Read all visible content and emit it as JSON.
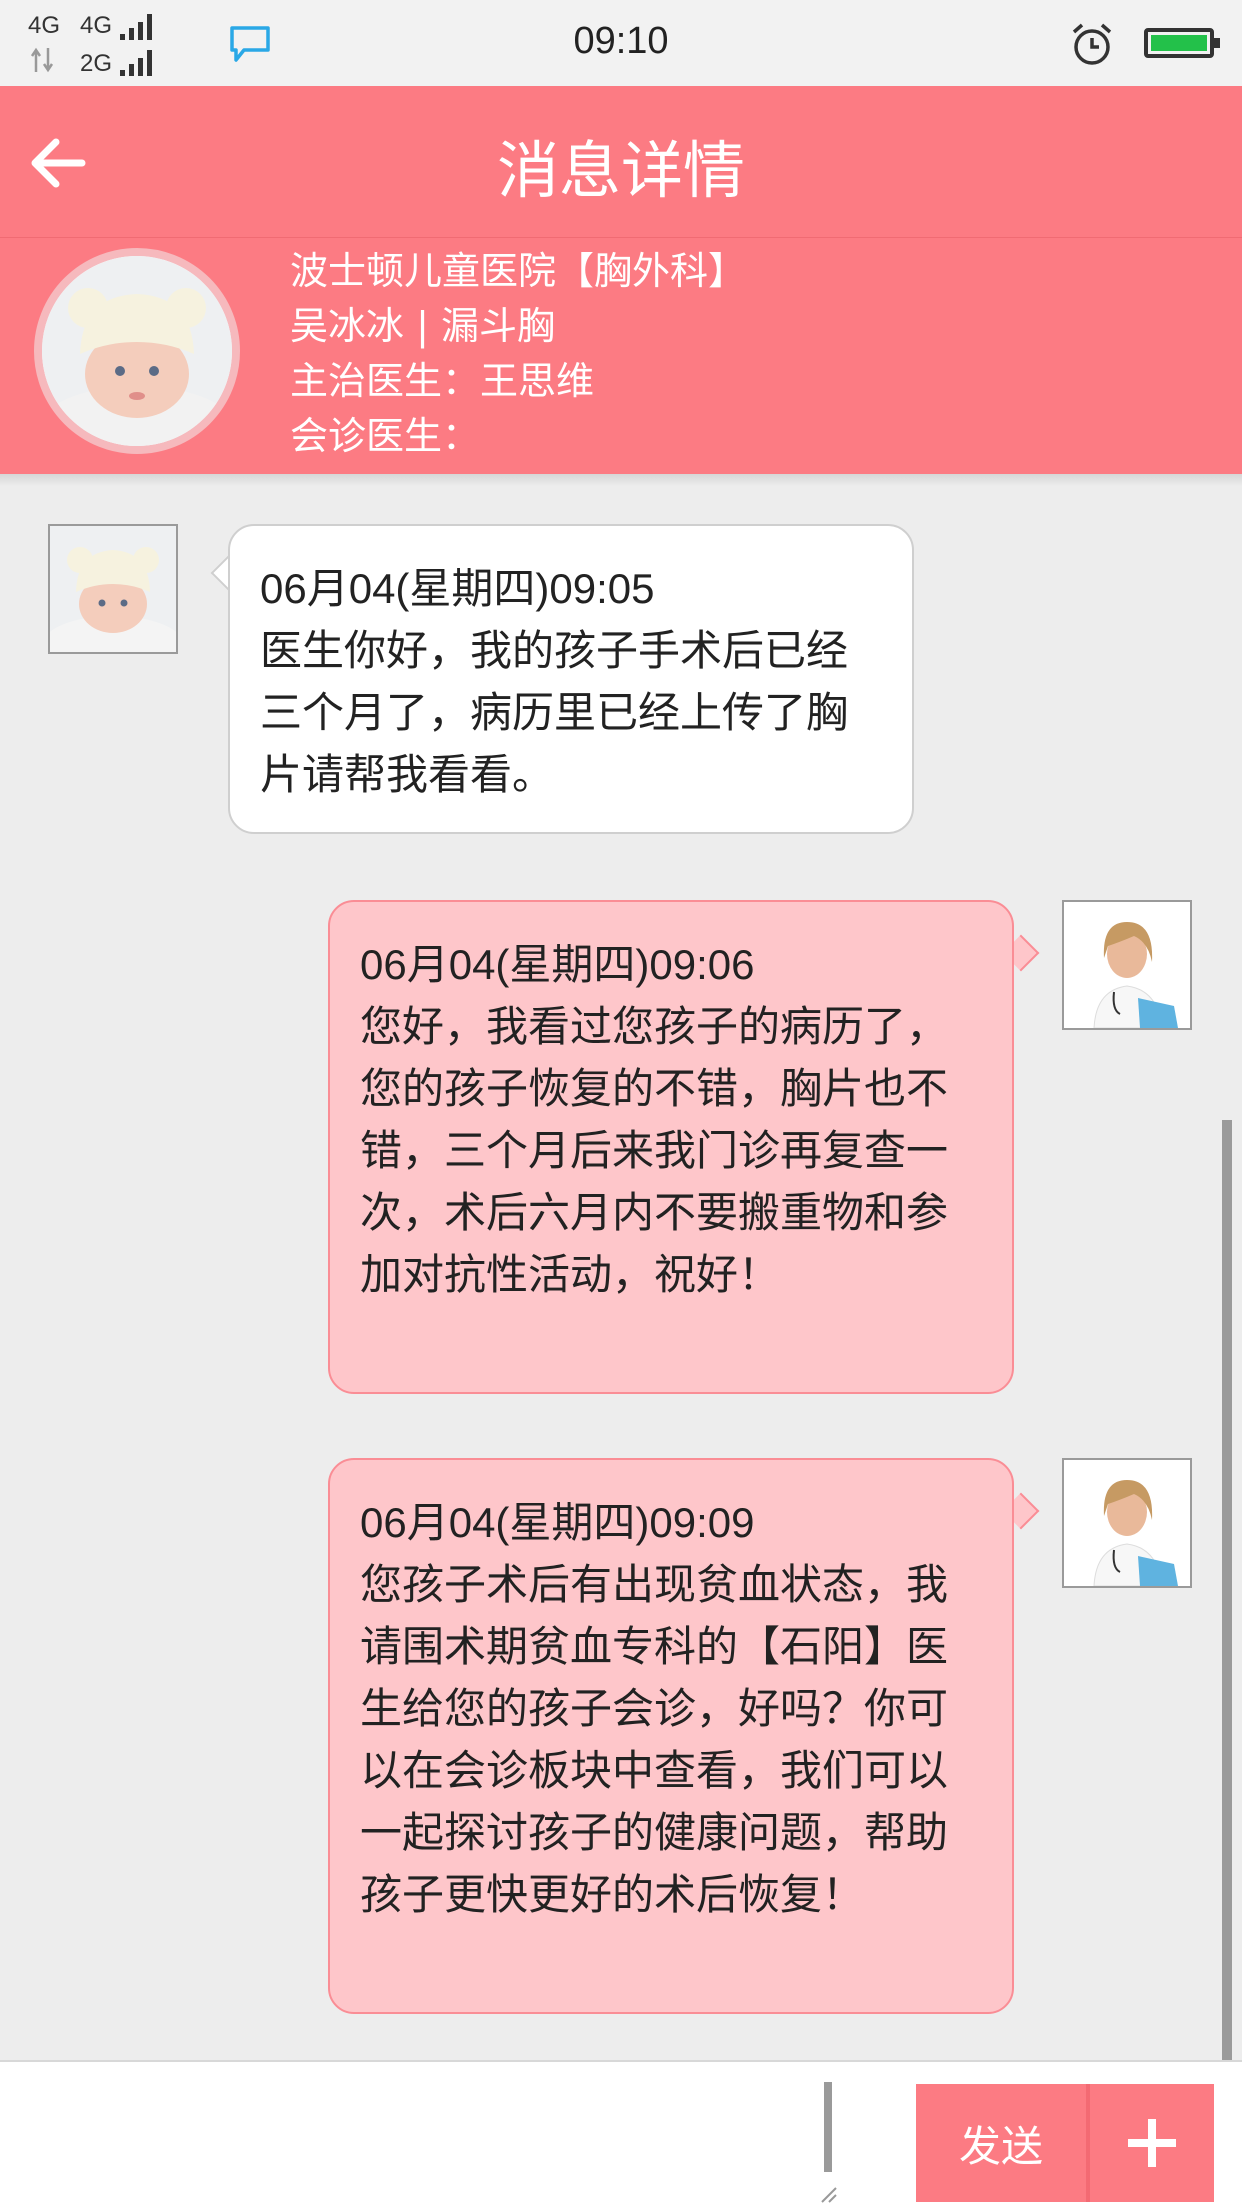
{
  "status_bar": {
    "net_top_left": "4G",
    "net_top_right": "4G",
    "net_bottom": "2G",
    "time": "09:10",
    "battery_color": "#23c14a"
  },
  "header": {
    "title": "消息详情",
    "back_icon": "arrow-left-icon",
    "bg_color": "#fc7b83"
  },
  "patient": {
    "hospital": "波士顿儿童医院【胸外科】",
    "name_condition": "吴冰冰 | 漏斗胸",
    "doctor": "主治医生：王思维",
    "consult": "会诊医生："
  },
  "messages": [
    {
      "from": "patient",
      "time": "06月04(星期四)09:05",
      "text": "医生你好，我的孩子手术后已经三个月了，病历里已经上传了胸片请帮我看看。"
    },
    {
      "from": "doctor",
      "time": "06月04(星期四)09:06",
      "text": "您好，我看过您孩子的病历了，您的孩子恢复的不错，胸片也不错，三个月后来我门诊再复查一次，术后六月内不要搬重物和参加对抗性活动，祝好！"
    },
    {
      "from": "doctor",
      "time": "06月04(星期四)09:09",
      "text": "您孩子术后有出现贫血状态，我请围术期贫血专科的【石阳】医生给您的孩子会诊，好吗？你可以在会诊板块中查看，我们可以一起探讨孩子的健康问题，帮助孩子更快更好的术后恢复！"
    }
  ],
  "input": {
    "send_label": "发送",
    "plus_icon": "plus-icon",
    "value": ""
  }
}
